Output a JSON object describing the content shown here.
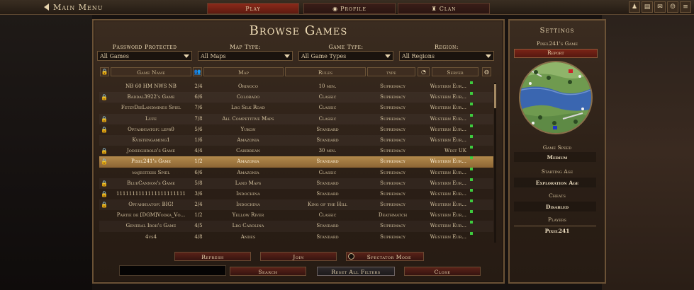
{
  "topbar": {
    "main_menu": "Main Menu",
    "tabs": [
      "Play",
      "Profile",
      "Clan"
    ]
  },
  "browse": {
    "title": "Browse Games",
    "filters": [
      {
        "label": "Password Protected",
        "value": "All Games"
      },
      {
        "label": "Map Type:",
        "value": "All Maps"
      },
      {
        "label": "Game Type:",
        "value": "All Game Types"
      },
      {
        "label": "Region:",
        "value": "All Regions"
      }
    ],
    "columns": {
      "name": "Game Name",
      "map": "Map",
      "rules": "Rules",
      "type": "type",
      "server": "Server"
    },
    "rows": [
      {
        "lock": false,
        "name": "NB 60 HM NWS NB",
        "players": "2/4",
        "map": "Orinoco",
        "rules": "10 min.",
        "type": "Supremacy",
        "server": "Western Eur..."
      },
      {
        "lock": true,
        "name": "Baddal3922's Game",
        "players": "6/6",
        "map": "Colorado",
        "rules": "Classic",
        "type": "Supremacy",
        "server": "Western Eur..."
      },
      {
        "lock": false,
        "name": "FetzyDieLandmines Spiel",
        "players": "7/6",
        "map": "Lrg Silk Road",
        "rules": "Classic",
        "type": "Supremacy",
        "server": "Western Eur..."
      },
      {
        "lock": true,
        "name": "Lufe",
        "players": "7/8",
        "map": "All Competitive Maps",
        "rules": "Classic",
        "type": "Supremacy",
        "server": "Western Eur..."
      },
      {
        "lock": true,
        "name": "Организатор: lepr0",
        "players": "5/6",
        "map": "Yukon",
        "rules": "Standard",
        "type": "Supremacy",
        "server": "Western Eur..."
      },
      {
        "lock": false,
        "name": "Kvistengaming1",
        "players": "1/6",
        "map": "Amazonia",
        "rules": "Standard",
        "type": "Supremacy",
        "server": "Western Eur..."
      },
      {
        "lock": true,
        "name": "Jodihighrolr's Game",
        "players": "4/4",
        "map": "Caribbean",
        "rules": "30 min.",
        "type": "Supremacy",
        "server": "West UK"
      },
      {
        "lock": true,
        "name": "Pixel241's Game",
        "players": "1/2",
        "map": "Amazonia",
        "rules": "Standard",
        "type": "Supremacy",
        "server": "Western Eur..."
      },
      {
        "lock": false,
        "name": "majestixiis Spiel",
        "players": "6/6",
        "map": "Amazonia",
        "rules": "Classic",
        "type": "Supremacy",
        "server": "Western Eur..."
      },
      {
        "lock": true,
        "name": "BlueCannon's Game",
        "players": "5/8",
        "map": "Land Maps",
        "rules": "Standard",
        "type": "Supremacy",
        "server": "Western Eur..."
      },
      {
        "lock": true,
        "name": "1111111111111111111111",
        "players": "3/6",
        "map": "Indochina",
        "rules": "Standard",
        "type": "Supremacy",
        "server": "Western Eur..."
      },
      {
        "lock": true,
        "name": "Организатор: BIG!",
        "players": "2/4",
        "map": "Indochina",
        "rules": "King of the Hill",
        "type": "Supremacy",
        "server": "Western Eur..."
      },
      {
        "lock": false,
        "name": "Partie de [DGM]Vodka_Vo...",
        "players": "1/2",
        "map": "Yellow River",
        "rules": "Classic",
        "type": "Deathmatch",
        "server": "Western Eur..."
      },
      {
        "lock": false,
        "name": "General Iroh's Game",
        "players": "4/5",
        "map": "Lrg Carolina",
        "rules": "Standard",
        "type": "Supremacy",
        "server": "Western Eur..."
      },
      {
        "lock": false,
        "name": "4vs4",
        "players": "4/8",
        "map": "Andes",
        "rules": "Standard",
        "type": "Supremacy",
        "server": "Western Eur..."
      }
    ],
    "selected_row": 7,
    "buttons": {
      "refresh": "Refresh",
      "join": "Join",
      "spectator": "Spectator Mode",
      "search": "Search",
      "reset": "Reset All Filters",
      "close": "Close"
    },
    "search_value": ""
  },
  "settings": {
    "title": "Settings",
    "game_name": "Pixel241's Game",
    "report": "Report",
    "game_speed_label": "Game Speed",
    "game_speed_value": "Medium",
    "starting_age_label": "Starting Age",
    "starting_age_value": "Exploration Age",
    "cheats_label": "Cheats",
    "cheats_value": "Disabled",
    "players_label": "Players",
    "player_1": "Pixel241"
  },
  "colors": {
    "accent_red": "#8a2a1a",
    "selected_row": "#b38a4c",
    "online_dot": "#3ecb3e"
  }
}
